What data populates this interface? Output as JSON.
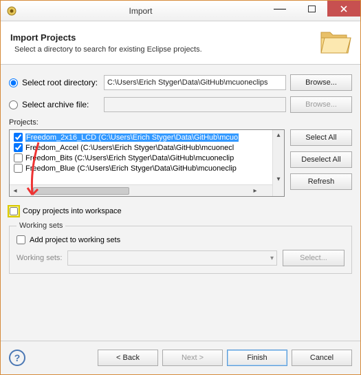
{
  "window": {
    "title": "Import"
  },
  "header": {
    "title": "Import Projects",
    "subtitle": "Select a directory to search for existing Eclipse projects."
  },
  "source": {
    "root_label": "Select root directory:",
    "root_value": "C:\\Users\\Erich Styger\\Data\\GitHub\\mcuoneclips",
    "archive_label": "Select archive file:",
    "archive_value": "",
    "browse_label": "Browse..."
  },
  "projects": {
    "label": "Projects:",
    "items": [
      {
        "checked": true,
        "selected": true,
        "text": "Freedom_2x16_LCD (C:\\Users\\Erich Styger\\Data\\GitHub\\mcuo"
      },
      {
        "checked": true,
        "selected": false,
        "text": "Freedom_Accel (C:\\Users\\Erich Styger\\Data\\GitHub\\mcuonecl"
      },
      {
        "checked": false,
        "selected": false,
        "text": "Freedom_Bits (C:\\Users\\Erich Styger\\Data\\GitHub\\mcuoneclip"
      },
      {
        "checked": false,
        "selected": false,
        "text": "Freedom_Blue (C:\\Users\\Erich Styger\\Data\\GitHub\\mcuoneclip"
      }
    ],
    "select_all": "Select All",
    "deselect_all": "Deselect All",
    "refresh": "Refresh"
  },
  "options": {
    "copy_label": "Copy projects into workspace"
  },
  "working_sets": {
    "legend": "Working sets",
    "add_label": "Add project to working sets",
    "combo_label": "Working sets:",
    "select_label": "Select..."
  },
  "footer": {
    "back": "< Back",
    "next": "Next >",
    "finish": "Finish",
    "cancel": "Cancel"
  }
}
